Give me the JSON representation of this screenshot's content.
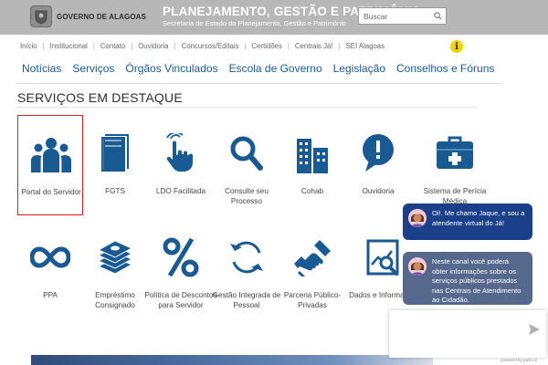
{
  "header": {
    "logo_text": "GOVERNO DE ALAGOAS",
    "title": "PLANEJAMENTO, GESTÃO E PATRIMÔNIO",
    "subtitle": "Secretaria de Estado do Planejamento, Gestão e Patrimônio",
    "search_placeholder": "Buscar"
  },
  "topnav": [
    {
      "label": "Início"
    },
    {
      "label": "Institucional"
    },
    {
      "label": "Contato"
    },
    {
      "label": "Ouvidoria"
    },
    {
      "label": "Concursos/Editais"
    },
    {
      "label": "Certidões"
    },
    {
      "label": "Centrais Já!"
    },
    {
      "label": "SEI Alagoas"
    }
  ],
  "info_glyph": "i",
  "mainnav": [
    {
      "label": "Notícias"
    },
    {
      "label": "Serviços"
    },
    {
      "label": "Órgãos Vinculados"
    },
    {
      "label": "Escola de Governo"
    },
    {
      "label": "Legislação"
    },
    {
      "label": "Conselhos e Fóruns"
    }
  ],
  "section_title": "SERVIÇOS EM DESTAQUE",
  "services_row1": [
    {
      "label": "Portal do Servidor",
      "icon": "users-icon"
    },
    {
      "label": "FGTS",
      "icon": "book-icon"
    },
    {
      "label": "LDO Facilitada",
      "icon": "hand-pointer-icon"
    },
    {
      "label": "Consulte seu Processo",
      "icon": "search-icon"
    },
    {
      "label": "Cohab",
      "icon": "building-icon"
    },
    {
      "label": "Ouvidoria",
      "icon": "speech-exclamation-icon"
    },
    {
      "label": "Sistema de Perícia Médica",
      "icon": "medical-kit-icon"
    }
  ],
  "services_row2": [
    {
      "label": "PPA",
      "icon": "infinity-icon"
    },
    {
      "label": "Empréstimo Consignado",
      "icon": "money-stack-icon"
    },
    {
      "label": "Política de Descontos para Servidor",
      "icon": "percent-icon"
    },
    {
      "label": "Gestão Integrada de Pessoal",
      "icon": "refresh-icon"
    },
    {
      "label": "Parceria Público-Privadas",
      "icon": "handshake-icon"
    },
    {
      "label": "Dados e Informações",
      "icon": "chart-search-icon"
    }
  ],
  "chat": {
    "message1": "Oi!. Me chamo Jaque, e sou a atendente virtual do Já!",
    "message2": "Neste canal você poderá obter informações sobre os serviços públicos prestados nas Centrais de Atendimento ao Cidadão.",
    "powered_by": "powered by push.ai"
  },
  "colors": {
    "header_bg": "#b7b7b7",
    "brand_blue": "#1a5a92",
    "selected_border": "#e02020",
    "chat_primary": "#1c3f8a",
    "chat_secondary": "#56698d"
  }
}
